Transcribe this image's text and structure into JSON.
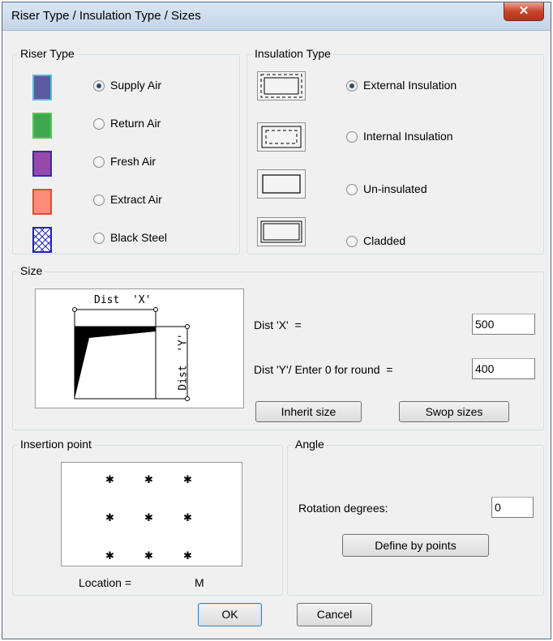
{
  "window": {
    "title": "Riser Type / Insulation Type / Sizes",
    "close_symbol": "✕"
  },
  "riser": {
    "group_label": "Riser Type",
    "items": [
      {
        "label": "Supply Air",
        "color": "#5a5aa0",
        "border": "#3cc8d8",
        "selected": true
      },
      {
        "label": "Return Air",
        "color": "#3fa84f",
        "border": "#56c35c",
        "selected": false
      },
      {
        "label": "Fresh Air",
        "color": "#9848a8",
        "border": "#3030a0",
        "selected": false
      },
      {
        "label": "Extract Air",
        "color": "#ff8c7a",
        "border": "#e04a3a",
        "selected": false
      },
      {
        "label": "Black Steel",
        "color": "#ffffff",
        "border": "#2020c0",
        "selected": false
      }
    ]
  },
  "insulation": {
    "group_label": "Insulation Type",
    "items": [
      {
        "label": "External Insulation",
        "selected": true
      },
      {
        "label": "Internal Insulation",
        "selected": false
      },
      {
        "label": "Un-insulated",
        "selected": false
      },
      {
        "label": "Cladded",
        "selected": false
      }
    ]
  },
  "size": {
    "group_label": "Size",
    "diagram": {
      "x_label": "Dist  'X'",
      "y_label": "Dist  'Y'"
    },
    "dist_x_label": "Dist 'X'  =",
    "dist_x_value": "500",
    "dist_y_label": "Dist 'Y'/ Enter 0 for round  =",
    "dist_y_value": "400",
    "inherit_button": "Inherit size",
    "swop_button": "Swop sizes"
  },
  "insertion": {
    "group_label": "Insertion point",
    "location_label": "Location =",
    "location_value": "M",
    "point_symbol": "✱"
  },
  "angle": {
    "group_label": "Angle",
    "rotation_label": "Rotation degrees:",
    "rotation_value": "0",
    "define_button": "Define by points"
  },
  "footer": {
    "ok": "OK",
    "cancel": "Cancel"
  }
}
